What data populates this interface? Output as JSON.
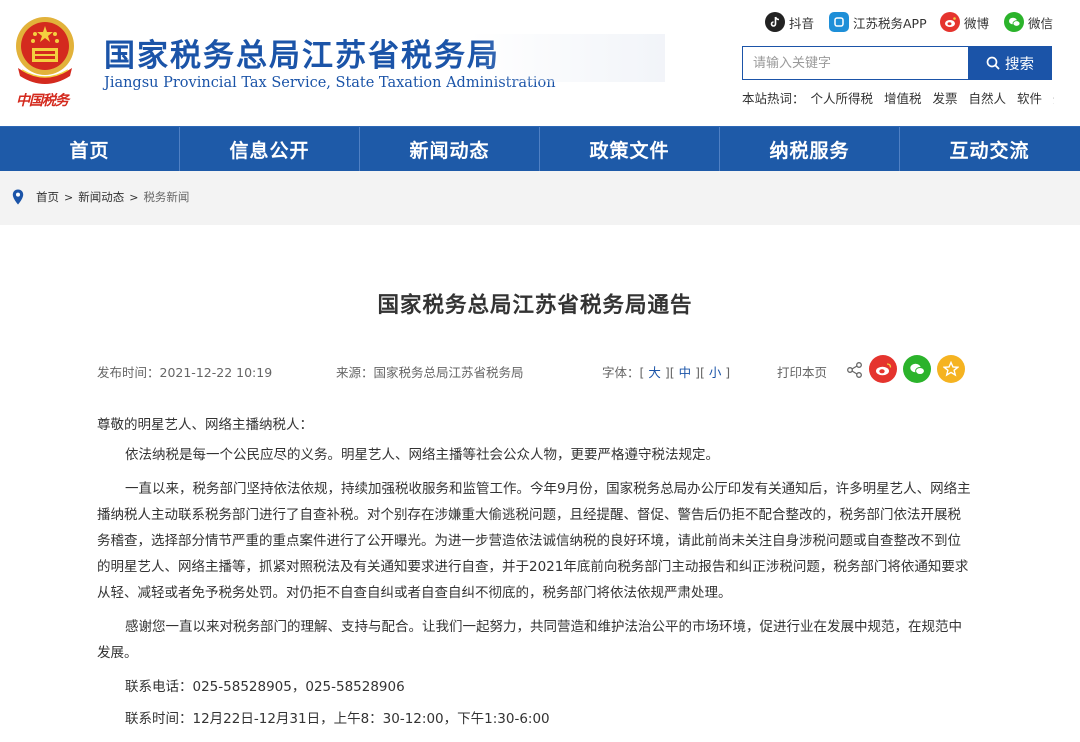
{
  "header": {
    "emblem_text": "中国税务",
    "title_cn": "国家税务总局江苏省税务局",
    "title_en": "Jiangsu Provincial Tax Service, State Taxation Administration",
    "social": [
      {
        "icon": "douyin-icon",
        "label": "抖音",
        "color": "#222222"
      },
      {
        "icon": "app-icon",
        "label": "江苏税务APP",
        "color": "#1e8fd8"
      },
      {
        "icon": "weibo-icon",
        "label": "微博",
        "color": "#e5342e"
      },
      {
        "icon": "wechat-icon",
        "label": "微信",
        "color": "#2bb32b"
      }
    ],
    "search": {
      "placeholder": "请输入关键字",
      "button": "搜索"
    },
    "hot_words": {
      "label": "本站热词：",
      "items": [
        "个人所得税",
        "增值税",
        "发票",
        "自然人",
        "软件",
        "开"
      ]
    }
  },
  "nav": [
    "首页",
    "信息公开",
    "新闻动态",
    "政策文件",
    "纳税服务",
    "互动交流"
  ],
  "breadcrumb": [
    "首页",
    "新闻动态",
    "税务新闻"
  ],
  "article": {
    "title": "国家税务总局江苏省税务局通告",
    "publish_time": "发布时间：2021-12-22 10:19",
    "source": "来源：国家税务总局江苏省税务局",
    "font_label": "字体：",
    "font_large": "大",
    "font_medium": "中",
    "font_small": "小",
    "print": "打印本页",
    "greeting": "尊敬的明星艺人、网络主播纳税人：",
    "paragraphs": [
      "依法纳税是每一个公民应尽的义务。明星艺人、网络主播等社会公众人物，更要严格遵守税法规定。",
      "一直以来，税务部门坚持依法依规，持续加强税收服务和监管工作。今年9月份，国家税务总局办公厅印发有关通知后，许多明星艺人、网络主播纳税人主动联系税务部门进行了自查补税。对个别存在涉嫌重大偷逃税问题，且经提醒、督促、警告后仍拒不配合整改的，税务部门依法开展税务稽查，选择部分情节严重的重点案件进行了公开曝光。为进一步营造依法诚信纳税的良好环境，请此前尚未关注自身涉税问题或自查整改不到位的明星艺人、网络主播等，抓紧对照税法及有关通知要求进行自查，并于2021年底前向税务部门主动报告和纠正涉税问题，税务部门将依通知要求从轻、减轻或者免予税务处罚。对仍拒不自查自纠或者自查自纠不彻底的，税务部门将依法依规严肃处理。",
      "感谢您一直以来对税务部门的理解、支持与配合。让我们一起努力，共同营造和维护法治公平的市场环境，促进行业在发展中规范，在规范中发展。"
    ],
    "contact_phone": "联系电话：025-58528905，025-58528906",
    "contact_time": "联系时间：12月22日-12月31日，上午8：30-12:00，下午1:30-6:00"
  },
  "colors": {
    "brand": "#1b54a8",
    "nav": "#1e5aa8",
    "emblem_red": "#d42a1e",
    "weibo": "#e5342e",
    "wechat": "#2bb32b",
    "star": "#f5b321"
  }
}
